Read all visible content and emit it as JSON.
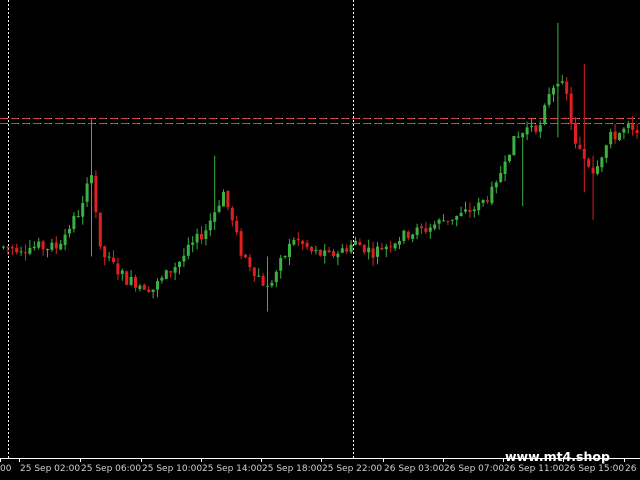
{
  "colors": {
    "background": "#000000",
    "bull_candle": "#3cb043",
    "bear_candle": "#e02020",
    "frame": "#ffffff",
    "separator": "#ffffff",
    "level_line": "#d04040",
    "axis_text": "#d0d0d0"
  },
  "watermark": "www.mt4.shop",
  "x_axis_labels": [
    "00",
    "25 Sep 02:00",
    "25 Sep 06:00",
    "25 Sep 10:00",
    "25 Sep 14:00",
    "25 Sep 18:00",
    "25 Sep 22:00",
    "26 Sep 03:00",
    "26 Sep 07:00",
    "26 Sep 11:00",
    "26 Sep 15:00",
    "26 S"
  ],
  "chart_data": {
    "type": "candlestick",
    "grid": false,
    "y_range": [
      0,
      100
    ],
    "level_lines": [
      74.2,
      73.2
    ],
    "session_separators": [
      6.5
    ],
    "x_label_positions": [
      0,
      1,
      2,
      3,
      4,
      5,
      6,
      7,
      8,
      9,
      10,
      11
    ],
    "anchors": [
      [
        0,
        46
      ],
      [
        6,
        46
      ],
      [
        9,
        55
      ],
      [
        10,
        63
      ],
      [
        11,
        45
      ],
      [
        14,
        39
      ],
      [
        17,
        37
      ],
      [
        20,
        43
      ],
      [
        23,
        50
      ],
      [
        25,
        58
      ],
      [
        27,
        45
      ],
      [
        30,
        37
      ],
      [
        33,
        48
      ],
      [
        35,
        45
      ],
      [
        37,
        44
      ],
      [
        40,
        47
      ],
      [
        42,
        45
      ],
      [
        44,
        47
      ],
      [
        46,
        49
      ],
      [
        48,
        50
      ],
      [
        50,
        52
      ],
      [
        52,
        53
      ],
      [
        54,
        55
      ],
      [
        56,
        59
      ],
      [
        57,
        66
      ],
      [
        58,
        69
      ],
      [
        60,
        73
      ],
      [
        61,
        72
      ],
      [
        62,
        80
      ],
      [
        63,
        83
      ],
      [
        64,
        79
      ],
      [
        65,
        68
      ],
      [
        67,
        63
      ],
      [
        69,
        70
      ],
      [
        71,
        72
      ],
      [
        72,
        70
      ]
    ],
    "spikes": [
      {
        "x": 10,
        "low": 44,
        "high": 74
      },
      {
        "x": 24,
        "low": 53,
        "high": 66
      },
      {
        "x": 30,
        "low": 32,
        "high": 44
      },
      {
        "x": 59,
        "low": 55,
        "high": 69
      },
      {
        "x": 63,
        "low": 70,
        "high": 95
      },
      {
        "x": 66,
        "low": 58,
        "high": 86
      },
      {
        "x": 67,
        "low": 52,
        "high": 66
      }
    ],
    "seed": 7
  }
}
